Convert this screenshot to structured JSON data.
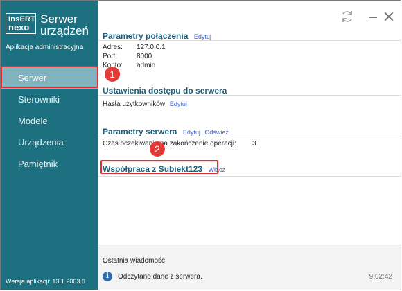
{
  "sidebar": {
    "logo_line1": "InsERT",
    "logo_line2": "nexo",
    "app_title_line1": "Serwer",
    "app_title_line2": "urządzeń",
    "subtitle": "Aplikacja administracyjna",
    "items": [
      {
        "label": "Serwer",
        "active": true
      },
      {
        "label": "Sterowniki",
        "active": false
      },
      {
        "label": "Modele",
        "active": false
      },
      {
        "label": "Urządzenia",
        "active": false
      },
      {
        "label": "Pamiętnik",
        "active": false
      }
    ],
    "version": "Wersja aplikacji:  13.1.2003.0"
  },
  "window": {
    "refresh_icon": "refresh-icon",
    "minimize_icon": "minimize-icon",
    "close_icon": "close-icon"
  },
  "connection": {
    "title": "Parametry połączenia",
    "edit_link": "Edytuj",
    "fields": [
      {
        "label": "Adres:",
        "value": "127.0.0.1"
      },
      {
        "label": "Port:",
        "value": "8000"
      },
      {
        "label": "Konto:",
        "value": "admin"
      }
    ]
  },
  "access": {
    "title": "Ustawienia dostępu do serwera",
    "field_label": "Hasła użytkowników",
    "edit_link": "Edytuj"
  },
  "server_params": {
    "title": "Parametry serwera",
    "edit_link": "Edytuj",
    "refresh_link": "Odśwież",
    "field_label": "Czas oczekiwania na zakończenie operacji:",
    "field_value": "3"
  },
  "subiekt": {
    "title": "Współpraca z Subiekt123",
    "enable_link": "Włącz"
  },
  "callouts": [
    "1",
    "2"
  ],
  "messages": {
    "title": "Ostatnia wiadomość",
    "icon": "info-icon",
    "text": "Odczytano dane z serwera.",
    "time": "9:02:42"
  }
}
